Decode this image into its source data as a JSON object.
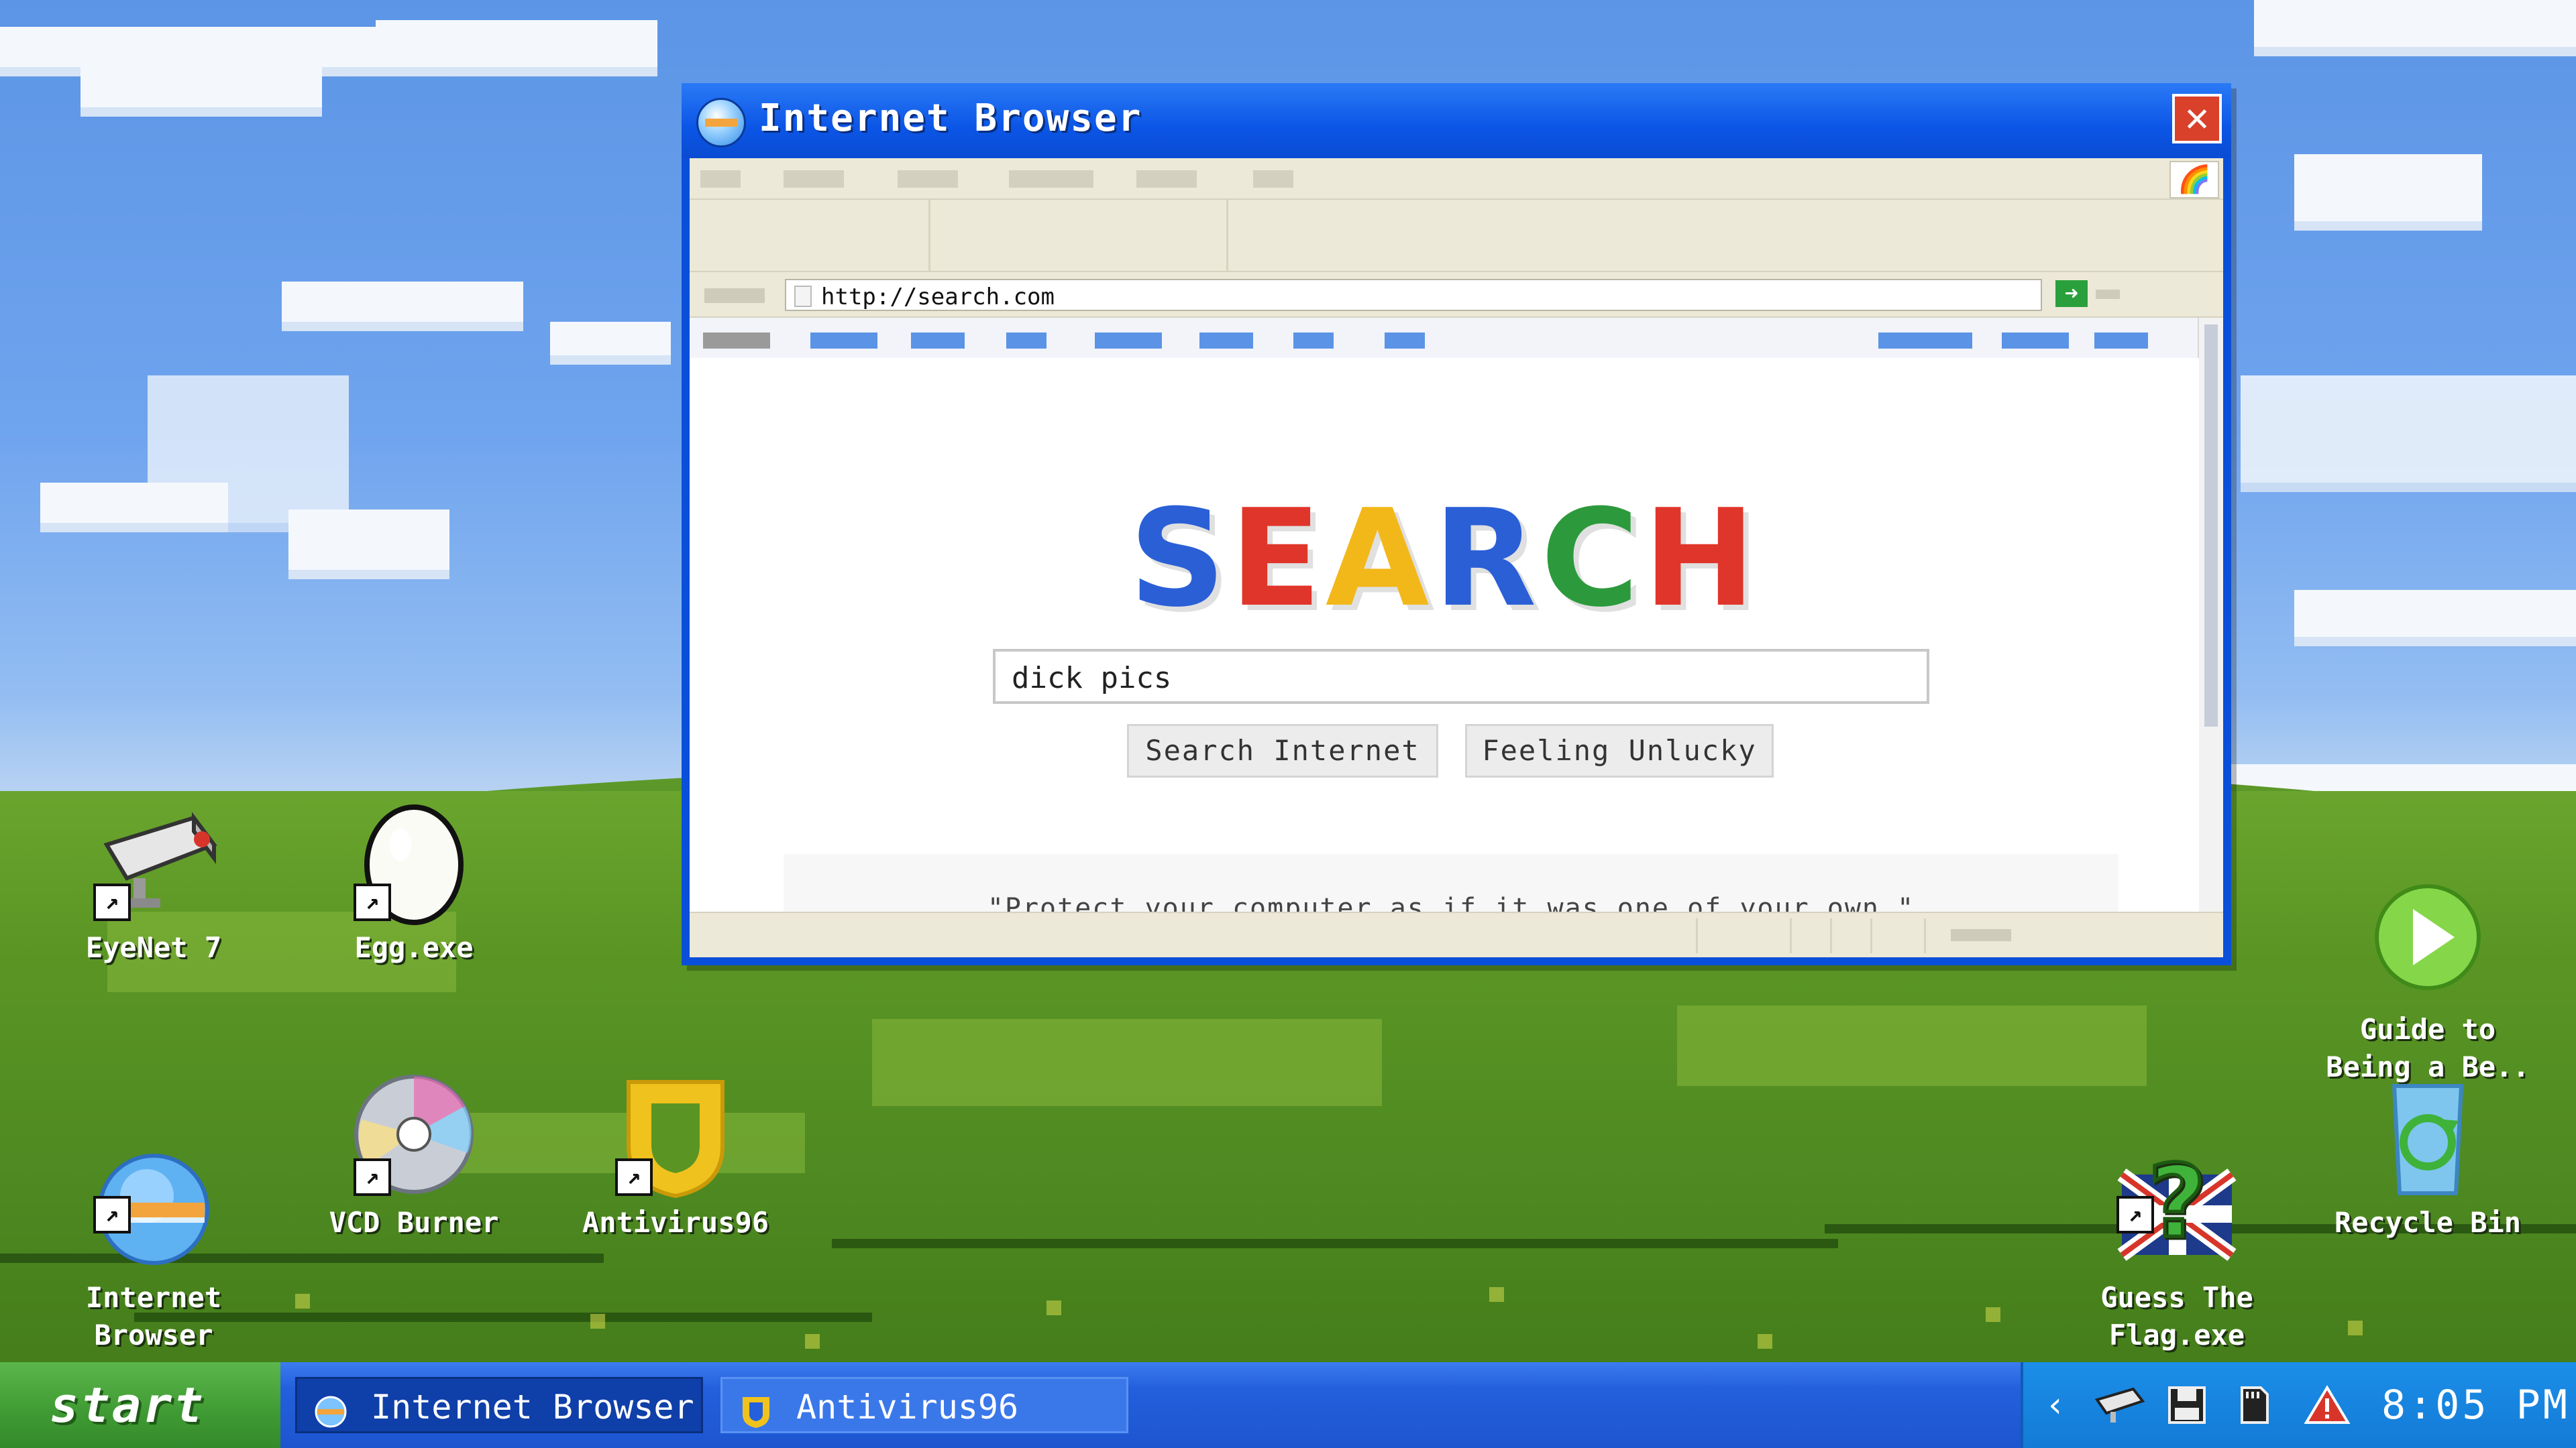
{
  "desktop": {
    "icons": [
      {
        "name": "EyeNet 7",
        "art": "security-camera"
      },
      {
        "name": "Egg.exe",
        "art": "egg"
      },
      {
        "name": "Internet\nBrowser",
        "art": "globe"
      },
      {
        "name": "VCD Burner",
        "art": "disc"
      },
      {
        "name": "Antivirus96",
        "art": "shield"
      },
      {
        "name": "Guide to\nBeing a Be..",
        "art": "play"
      },
      {
        "name": "Guess The\nFlag.exe",
        "art": "question-flag"
      },
      {
        "name": "Recycle Bin",
        "art": "recycle-bin"
      }
    ]
  },
  "browser": {
    "title": "Internet Browser",
    "close_symbol": "✕",
    "address_url": "http://search.com",
    "go_symbol": "➜",
    "logo_letters": [
      {
        "ch": "S",
        "color": "#2a5fd6"
      },
      {
        "ch": "E",
        "color": "#e0352a"
      },
      {
        "ch": "A",
        "color": "#f2b81a"
      },
      {
        "ch": "R",
        "color": "#2a5fd6"
      },
      {
        "ch": "C",
        "color": "#2c9a3c"
      },
      {
        "ch": "H",
        "color": "#e0352a"
      }
    ],
    "search_query": "dick pics",
    "search_button": "Search Internet",
    "lucky_button": "Feeling Unlucky",
    "quote": "\"Protect your computer as if it was one of your own.\""
  },
  "taskbar": {
    "start_label": "start",
    "tasks": [
      {
        "label": "Internet Browser",
        "icon": "globe-icon"
      },
      {
        "label": "Antivirus96",
        "icon": "shield-icon"
      }
    ],
    "tray": {
      "chevron": "‹",
      "clock": "8:05 PM",
      "icons": [
        "camera-icon",
        "floppy-icon",
        "sd-card-icon",
        "warning-icon"
      ]
    }
  },
  "colors": {
    "title_bar": "#0b55e6",
    "taskbar": "#1d55cf",
    "start_button": "#3f9a33",
    "tray": "#137bd6"
  }
}
